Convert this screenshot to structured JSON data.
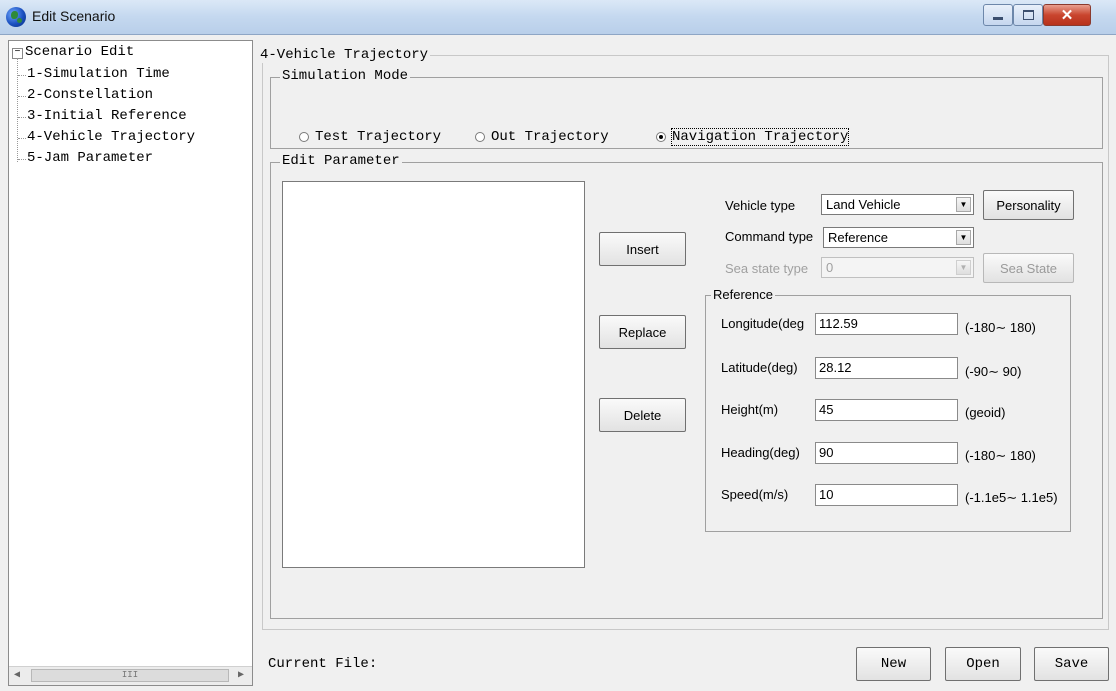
{
  "window": {
    "title": "Edit Scenario"
  },
  "tree": {
    "root": "Scenario Edit",
    "items": [
      {
        "label": "1-Simulation Time"
      },
      {
        "label": "2-Constellation"
      },
      {
        "label": "3-Initial Reference"
      },
      {
        "label": "4-Vehicle Trajectory"
      },
      {
        "label": "5-Jam Parameter"
      }
    ],
    "scroll_thumb": "III"
  },
  "panel": {
    "title": "4-Vehicle Trajectory",
    "sim_mode": {
      "title": "Simulation Mode",
      "options": [
        "Test Trajectory",
        "Out Trajectory",
        "Navigation Trajectory"
      ],
      "selected": "Navigation Trajectory"
    },
    "edit": {
      "title": "Edit Parameter",
      "buttons": {
        "insert": "Insert",
        "replace": "Replace",
        "delete": "Delete"
      },
      "vehicle_type": {
        "label": "Vehicle type",
        "value": "Land Vehicle"
      },
      "personality_button": "Personality",
      "command_type": {
        "label": "Command type",
        "value": "Reference"
      },
      "sea_state_type": {
        "label": "Sea state type",
        "value": "0",
        "disabled": true
      },
      "sea_state_button": "Sea State",
      "reference": {
        "title": "Reference",
        "fields": [
          {
            "label": "Longitude(deg",
            "value": "112.59",
            "range": "(-180∼ 180)"
          },
          {
            "label": "Latitude(deg)",
            "value": "28.12",
            "range": "(-90∼ 90)"
          },
          {
            "label": "Height(m)",
            "value": "45",
            "range": "(geoid)"
          },
          {
            "label": "Heading(deg)",
            "value": "90",
            "range": "(-180∼ 180)"
          },
          {
            "label": "Speed(m/s)",
            "value": "10",
            "range": "(-1.1e5∼ 1.1e5)"
          }
        ]
      }
    }
  },
  "footer": {
    "current_file_label": "Current File:",
    "buttons": {
      "new": "New",
      "open": "Open",
      "save": "Save"
    }
  }
}
